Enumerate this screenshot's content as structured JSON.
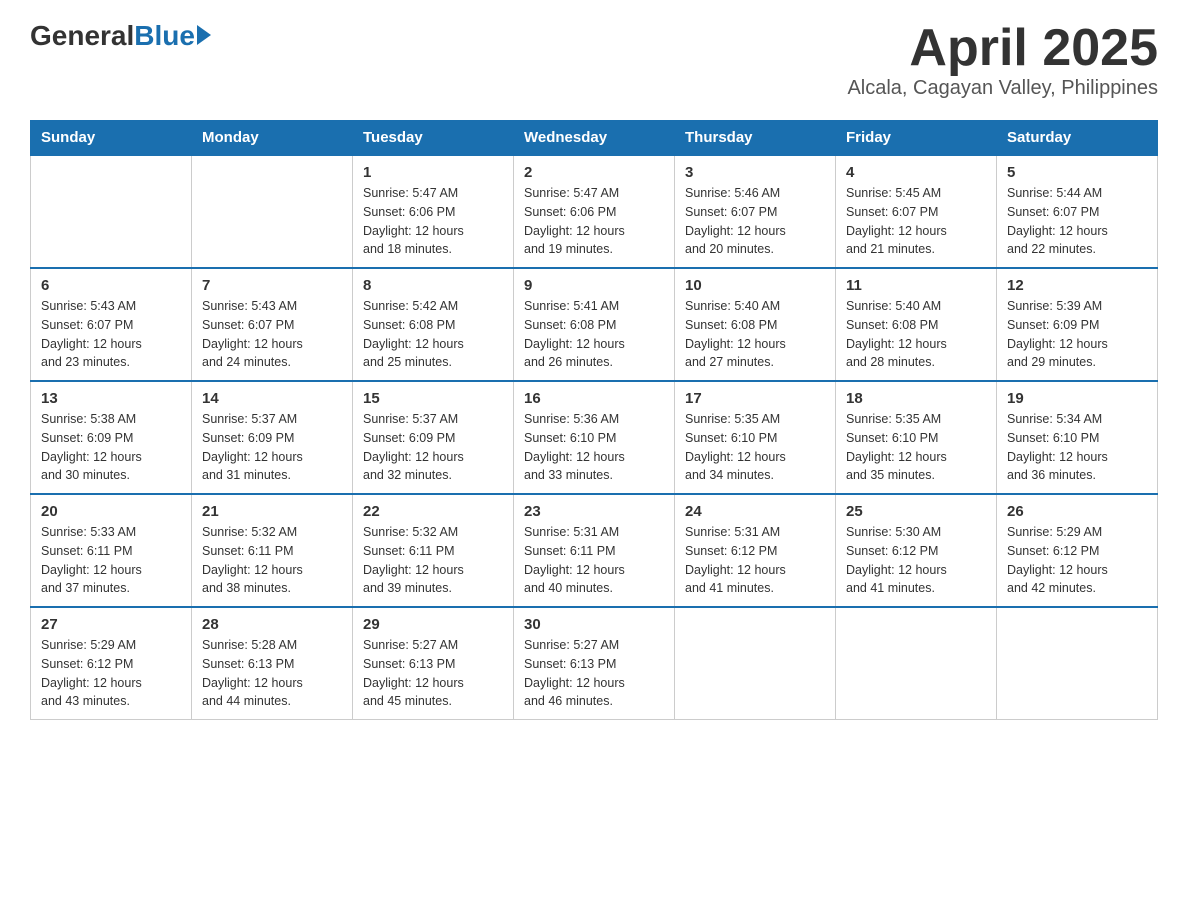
{
  "logo": {
    "general": "General",
    "blue": "Blue"
  },
  "title": "April 2025",
  "subtitle": "Alcala, Cagayan Valley, Philippines",
  "weekdays": [
    "Sunday",
    "Monday",
    "Tuesday",
    "Wednesday",
    "Thursday",
    "Friday",
    "Saturday"
  ],
  "weeks": [
    [
      {
        "day": "",
        "info": ""
      },
      {
        "day": "",
        "info": ""
      },
      {
        "day": "1",
        "info": "Sunrise: 5:47 AM\nSunset: 6:06 PM\nDaylight: 12 hours\nand 18 minutes."
      },
      {
        "day": "2",
        "info": "Sunrise: 5:47 AM\nSunset: 6:06 PM\nDaylight: 12 hours\nand 19 minutes."
      },
      {
        "day": "3",
        "info": "Sunrise: 5:46 AM\nSunset: 6:07 PM\nDaylight: 12 hours\nand 20 minutes."
      },
      {
        "day": "4",
        "info": "Sunrise: 5:45 AM\nSunset: 6:07 PM\nDaylight: 12 hours\nand 21 minutes."
      },
      {
        "day": "5",
        "info": "Sunrise: 5:44 AM\nSunset: 6:07 PM\nDaylight: 12 hours\nand 22 minutes."
      }
    ],
    [
      {
        "day": "6",
        "info": "Sunrise: 5:43 AM\nSunset: 6:07 PM\nDaylight: 12 hours\nand 23 minutes."
      },
      {
        "day": "7",
        "info": "Sunrise: 5:43 AM\nSunset: 6:07 PM\nDaylight: 12 hours\nand 24 minutes."
      },
      {
        "day": "8",
        "info": "Sunrise: 5:42 AM\nSunset: 6:08 PM\nDaylight: 12 hours\nand 25 minutes."
      },
      {
        "day": "9",
        "info": "Sunrise: 5:41 AM\nSunset: 6:08 PM\nDaylight: 12 hours\nand 26 minutes."
      },
      {
        "day": "10",
        "info": "Sunrise: 5:40 AM\nSunset: 6:08 PM\nDaylight: 12 hours\nand 27 minutes."
      },
      {
        "day": "11",
        "info": "Sunrise: 5:40 AM\nSunset: 6:08 PM\nDaylight: 12 hours\nand 28 minutes."
      },
      {
        "day": "12",
        "info": "Sunrise: 5:39 AM\nSunset: 6:09 PM\nDaylight: 12 hours\nand 29 minutes."
      }
    ],
    [
      {
        "day": "13",
        "info": "Sunrise: 5:38 AM\nSunset: 6:09 PM\nDaylight: 12 hours\nand 30 minutes."
      },
      {
        "day": "14",
        "info": "Sunrise: 5:37 AM\nSunset: 6:09 PM\nDaylight: 12 hours\nand 31 minutes."
      },
      {
        "day": "15",
        "info": "Sunrise: 5:37 AM\nSunset: 6:09 PM\nDaylight: 12 hours\nand 32 minutes."
      },
      {
        "day": "16",
        "info": "Sunrise: 5:36 AM\nSunset: 6:10 PM\nDaylight: 12 hours\nand 33 minutes."
      },
      {
        "day": "17",
        "info": "Sunrise: 5:35 AM\nSunset: 6:10 PM\nDaylight: 12 hours\nand 34 minutes."
      },
      {
        "day": "18",
        "info": "Sunrise: 5:35 AM\nSunset: 6:10 PM\nDaylight: 12 hours\nand 35 minutes."
      },
      {
        "day": "19",
        "info": "Sunrise: 5:34 AM\nSunset: 6:10 PM\nDaylight: 12 hours\nand 36 minutes."
      }
    ],
    [
      {
        "day": "20",
        "info": "Sunrise: 5:33 AM\nSunset: 6:11 PM\nDaylight: 12 hours\nand 37 minutes."
      },
      {
        "day": "21",
        "info": "Sunrise: 5:32 AM\nSunset: 6:11 PM\nDaylight: 12 hours\nand 38 minutes."
      },
      {
        "day": "22",
        "info": "Sunrise: 5:32 AM\nSunset: 6:11 PM\nDaylight: 12 hours\nand 39 minutes."
      },
      {
        "day": "23",
        "info": "Sunrise: 5:31 AM\nSunset: 6:11 PM\nDaylight: 12 hours\nand 40 minutes."
      },
      {
        "day": "24",
        "info": "Sunrise: 5:31 AM\nSunset: 6:12 PM\nDaylight: 12 hours\nand 41 minutes."
      },
      {
        "day": "25",
        "info": "Sunrise: 5:30 AM\nSunset: 6:12 PM\nDaylight: 12 hours\nand 41 minutes."
      },
      {
        "day": "26",
        "info": "Sunrise: 5:29 AM\nSunset: 6:12 PM\nDaylight: 12 hours\nand 42 minutes."
      }
    ],
    [
      {
        "day": "27",
        "info": "Sunrise: 5:29 AM\nSunset: 6:12 PM\nDaylight: 12 hours\nand 43 minutes."
      },
      {
        "day": "28",
        "info": "Sunrise: 5:28 AM\nSunset: 6:13 PM\nDaylight: 12 hours\nand 44 minutes."
      },
      {
        "day": "29",
        "info": "Sunrise: 5:27 AM\nSunset: 6:13 PM\nDaylight: 12 hours\nand 45 minutes."
      },
      {
        "day": "30",
        "info": "Sunrise: 5:27 AM\nSunset: 6:13 PM\nDaylight: 12 hours\nand 46 minutes."
      },
      {
        "day": "",
        "info": ""
      },
      {
        "day": "",
        "info": ""
      },
      {
        "day": "",
        "info": ""
      }
    ]
  ]
}
